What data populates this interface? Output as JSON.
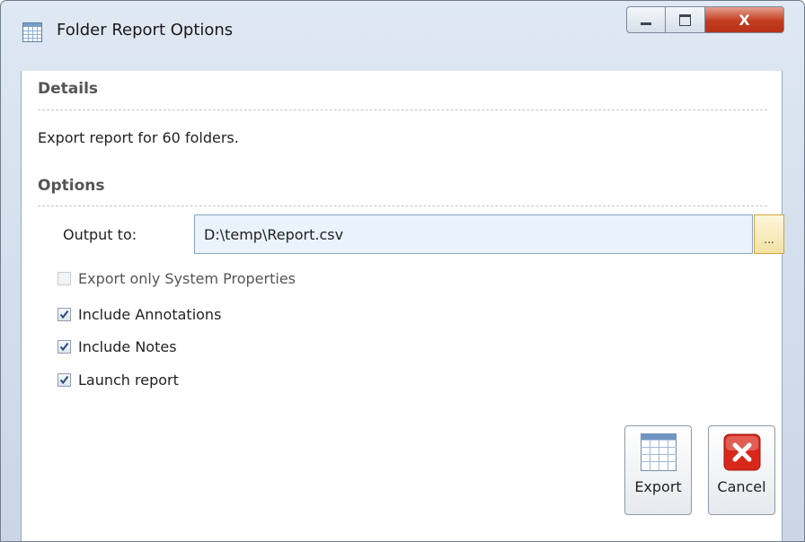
{
  "window": {
    "title": "Folder Report Options",
    "close_label": "X"
  },
  "details": {
    "heading": "Details",
    "text": "Export report for 60 folders."
  },
  "options": {
    "heading": "Options",
    "output_label": "Output to:",
    "output_value": "D:\\temp\\Report.csv",
    "browse_label": "...",
    "checkboxes": [
      {
        "label": "Export only System Properties",
        "checked": false,
        "enabled": false
      },
      {
        "label": "Include Annotations",
        "checked": true,
        "enabled": true
      },
      {
        "label": "Include Notes",
        "checked": true,
        "enabled": true
      },
      {
        "label": "Launch report",
        "checked": true,
        "enabled": true
      }
    ]
  },
  "actions": {
    "export_label": "Export",
    "cancel_label": "Cancel"
  },
  "icons": {
    "app": "table-icon",
    "export": "spreadsheet-icon",
    "cancel": "red-x-icon"
  },
  "colors": {
    "accent": "#8aa6c8",
    "close_button": "#c23c1e",
    "cancel_icon": "#d8281c",
    "input_background": "#eaf2fb"
  }
}
